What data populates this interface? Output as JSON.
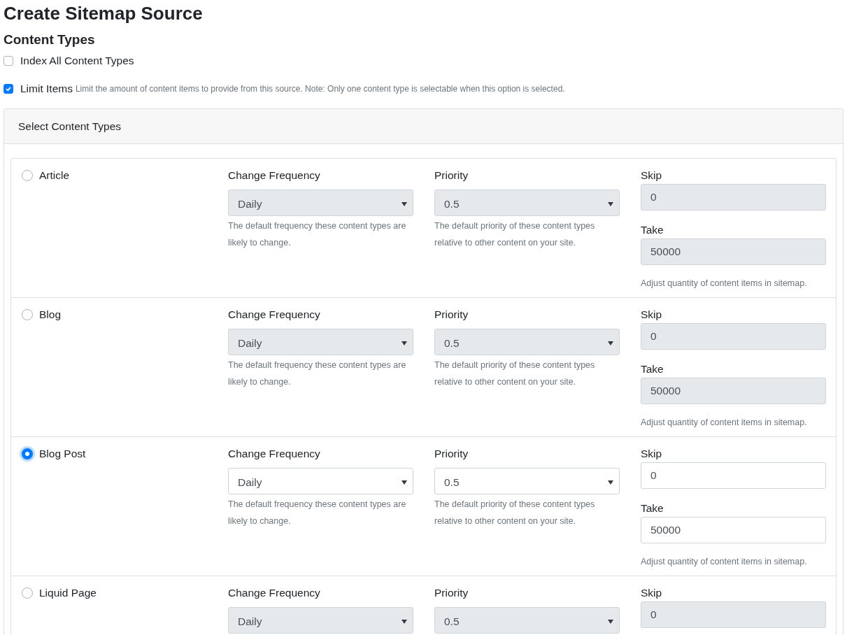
{
  "title": "Create Sitemap Source",
  "section_title": "Content Types",
  "options": [
    {
      "label": "Index All Content Types",
      "checked": false
    },
    {
      "label": "Limit Items",
      "checked": true,
      "hint": "Limit the amount of content items to provide from this source. Note: Only one content type is selectable when this option is selected."
    }
  ],
  "card": {
    "header": "Select Content Types",
    "rows": [
      {
        "name": "Article",
        "selected": false,
        "disabled": true,
        "frequency": {
          "label": "Change Frequency",
          "value": "Daily",
          "help": "The default frequency these content types are likely to change."
        },
        "priority": {
          "label": "Priority",
          "value": "0.5",
          "help": "The default priority of these content types relative to other content on your site."
        },
        "skip": {
          "label": "Skip",
          "value": "0"
        },
        "take": {
          "label": "Take",
          "value": "50000"
        },
        "help": "Adjust quantity of content items in sitemap."
      },
      {
        "name": "Blog",
        "selected": false,
        "disabled": true,
        "frequency": {
          "label": "Change Frequency",
          "value": "Daily",
          "help": "The default frequency these content types are likely to change."
        },
        "priority": {
          "label": "Priority",
          "value": "0.5",
          "help": "The default priority of these content types relative to other content on your site."
        },
        "skip": {
          "label": "Skip",
          "value": "0"
        },
        "take": {
          "label": "Take",
          "value": "50000"
        },
        "help": "Adjust quantity of content items in sitemap."
      },
      {
        "name": "Blog Post",
        "selected": true,
        "disabled": false,
        "frequency": {
          "label": "Change Frequency",
          "value": "Daily",
          "help": "The default frequency these content types are likely to change."
        },
        "priority": {
          "label": "Priority",
          "value": "0.5",
          "help": "The default priority of these content types relative to other content on your site."
        },
        "skip": {
          "label": "Skip",
          "value": "0"
        },
        "take": {
          "label": "Take",
          "value": "50000"
        },
        "help": "Adjust quantity of content items in sitemap."
      },
      {
        "name": "Liquid Page",
        "selected": false,
        "disabled": true,
        "frequency": {
          "label": "Change Frequency",
          "value": "Daily"
        },
        "priority": {
          "label": "Priority",
          "value": "0.5"
        },
        "skip": {
          "label": "Skip",
          "value": "0"
        }
      }
    ]
  }
}
